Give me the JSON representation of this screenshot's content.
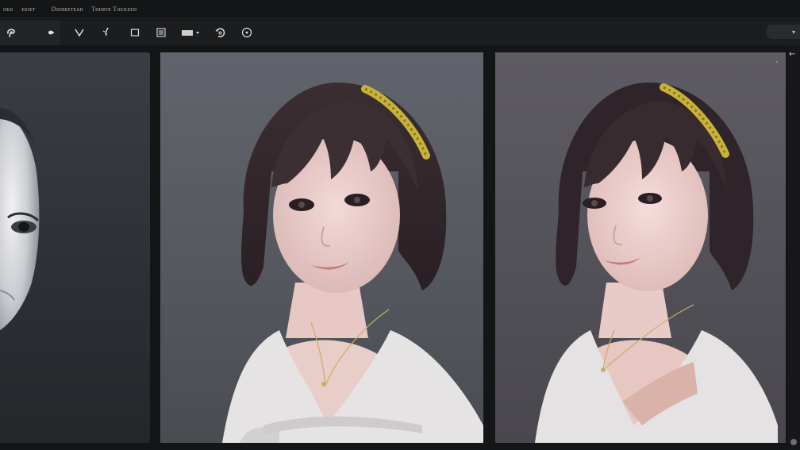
{
  "menu": {
    "items": [
      "ᴏᴋᴋ",
      "ᴇᴇɪᴇᴛ",
      "Dᴏɪɴᴇᴇᴛᴇᴀᴅ",
      "Tʜɪᴍᴠᴇ Tᴏᴜᴋᴇᴇᴅ"
    ]
  },
  "toolbar": {
    "tools": [
      {
        "name": "lasso-tool",
        "icon": "lasso-icon"
      },
      {
        "name": "dot-tool",
        "icon": "dot-icon"
      },
      {
        "name": "select-tool",
        "icon": "checkmark-icon"
      },
      {
        "name": "brush-tool",
        "icon": "brush-icon"
      },
      {
        "name": "crop-tool",
        "icon": "square-icon"
      },
      {
        "name": "layers-tool",
        "icon": "grid-icon"
      },
      {
        "name": "fill-tool",
        "icon": "rectangle-icon"
      },
      {
        "name": "rotate-tool",
        "icon": "rotate-icon"
      },
      {
        "name": "info-tool",
        "icon": "circle-icon"
      }
    ],
    "select_caret": "▾"
  },
  "panels": [
    {
      "name": "preview-left",
      "content": "grayscale face close-up"
    },
    {
      "name": "preview-middle",
      "content": "portrait with bob haircut"
    },
    {
      "name": "preview-right",
      "content": "portrait with bob haircut variant"
    }
  ],
  "strip": {
    "arrow": "←"
  },
  "colors": {
    "background": "#111213",
    "toolbar": "#1c1d1f",
    "accent_gold": "#c9b23a"
  }
}
